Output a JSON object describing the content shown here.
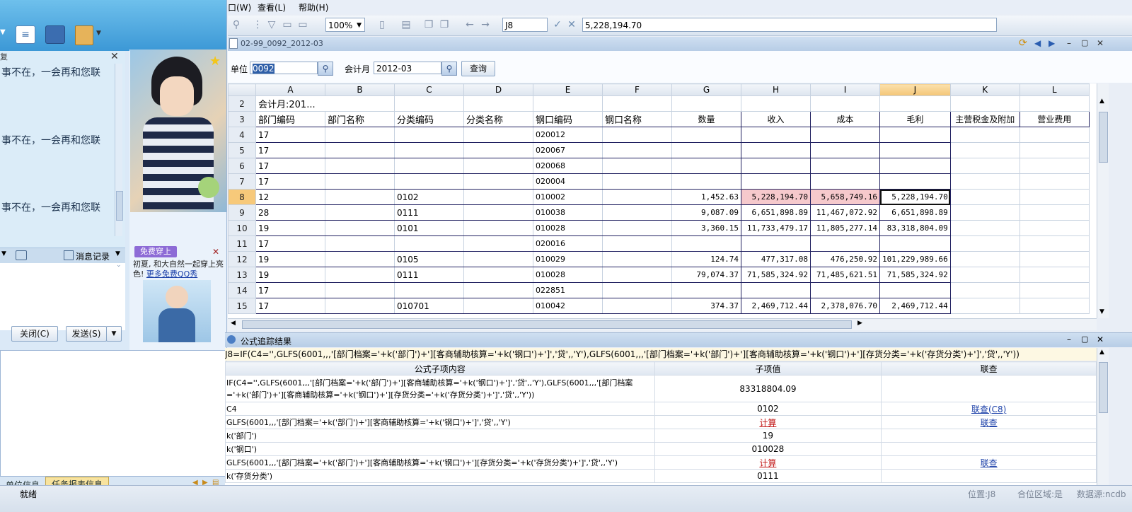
{
  "chat": {
    "messages": [
      "事不在，一会再和您联",
      "事不在，一会再和您联",
      "事不在，一会再和您联"
    ],
    "history_label": "消息记录",
    "close_btn": "关闭(C)",
    "send_btn": "发送(S)",
    "promo_badge": "免费穿上",
    "promo_text": "初夏, 和大自然一起穿上亮色!",
    "promo_link": "更多免费QQ秀",
    "tabs": [
      "单位信息",
      "任务报表信息"
    ]
  },
  "menu": {
    "items": [
      "口(W)",
      "查看(L)",
      "帮助(H)"
    ]
  },
  "toolbar": {
    "zoom": "100%",
    "cell_ref": "J8",
    "formula_value": "5,228,194.70"
  },
  "doc": {
    "title": "02-99_0092_2012-03"
  },
  "query": {
    "unit_label": "单位",
    "unit_value": "0092",
    "period_label": "会计月",
    "period_value": "2012-03",
    "query_btn": "查询"
  },
  "grid": {
    "col_letters": [
      "A",
      "B",
      "C",
      "D",
      "E",
      "F",
      "G",
      "H",
      "I",
      "J",
      "K",
      "L"
    ],
    "row2_label": "会计月:201...",
    "headers": [
      "部门编码",
      "部门名称",
      "分类编码",
      "分类名称",
      "钢口编码",
      "钢口名称",
      "数量",
      "收入",
      "成本",
      "毛利",
      "主营税金及附加",
      "营业费用"
    ],
    "rows": [
      {
        "n": "4",
        "a": "17",
        "c": "",
        "e": "020012",
        "g": "",
        "h": "",
        "i": "",
        "j": ""
      },
      {
        "n": "5",
        "a": "17",
        "c": "",
        "e": "020067",
        "g": "",
        "h": "",
        "i": "",
        "j": ""
      },
      {
        "n": "6",
        "a": "17",
        "c": "",
        "e": "020068",
        "g": "",
        "h": "",
        "i": "",
        "j": ""
      },
      {
        "n": "7",
        "a": "17",
        "c": "",
        "e": "020004",
        "g": "",
        "h": "",
        "i": "",
        "j": ""
      },
      {
        "n": "8",
        "a": "12",
        "c": "0102",
        "e": "010002",
        "g": "1,452.63",
        "h": "5,228,194.70",
        "i": "5,658,749.16",
        "j": "5,228,194.70"
      },
      {
        "n": "9",
        "a": "28",
        "c": "0111",
        "e": "010038",
        "g": "9,087.09",
        "h": "6,651,898.89",
        "i": "11,467,072.92",
        "j": "6,651,898.89"
      },
      {
        "n": "10",
        "a": "19",
        "c": "0101",
        "e": "010028",
        "g": "3,360.15",
        "h": "11,733,479.17",
        "i": "11,805,277.14",
        "j": "83,318,804.09"
      },
      {
        "n": "11",
        "a": "17",
        "c": "",
        "e": "020016",
        "g": "",
        "h": "",
        "i": "",
        "j": ""
      },
      {
        "n": "12",
        "a": "19",
        "c": "0105",
        "e": "010029",
        "g": "124.74",
        "h": "477,317.08",
        "i": "476,250.92",
        "j": "101,229,989.66"
      },
      {
        "n": "13",
        "a": "19",
        "c": "0111",
        "e": "010028",
        "g": "79,074.37",
        "h": "71,585,324.92",
        "i": "71,485,621.51",
        "j": "71,585,324.92"
      },
      {
        "n": "14",
        "a": "17",
        "c": "",
        "e": "022851",
        "g": "",
        "h": "",
        "i": "",
        "j": ""
      },
      {
        "n": "15",
        "a": "17",
        "c": "010701",
        "e": "010042",
        "g": "374.37",
        "h": "2,469,712.44",
        "i": "2,378,076.70",
        "j": "2,469,712.44"
      }
    ]
  },
  "trace": {
    "title": "公式追踪结果",
    "formula": "J8=IF(C4='',GLFS(6001,,,'[部门档案='+k('部门')+'][客商辅助核算='+k('钢口')+']','贷',,'Y'),GLFS(6001,,,'[部门档案='+k('部门')+'][客商辅助核算='+k('钢口')+'][存货分类='+k('存货分类')+']','贷',,'Y'))",
    "headers": [
      "公式子项内容",
      "子项值",
      "联查"
    ],
    "rows": [
      {
        "content": "IF(C4='',GLFS(6001,,,'[部门档案='+k('部门')+'][客商辅助核算='+k('钢口')+']','贷',,'Y'),GLFS(6001,,,'[部门档案='+k('部门')+'][客商辅助核算='+k('钢口')+'][存货分类='+k('存货分类')+']','贷',,'Y'))",
        "value": "83318804.09",
        "value_kind": "text",
        "link": ""
      },
      {
        "content": "C4",
        "value": "0102",
        "value_kind": "text",
        "link": "联查(C8)"
      },
      {
        "content": "GLFS(6001,,,'[部门档案='+k('部门')+'][客商辅助核算='+k('钢口')+']','贷',,'Y')",
        "value": "计算",
        "value_kind": "calc",
        "link": "联查"
      },
      {
        "content": "k('部门')",
        "value": "19",
        "value_kind": "text",
        "link": ""
      },
      {
        "content": "k('钢口')",
        "value": "010028",
        "value_kind": "text",
        "link": ""
      },
      {
        "content": "GLFS(6001,,,'[部门档案='+k('部门')+'][客商辅助核算='+k('钢口')+'][存货分类='+k('存货分类')+']','贷',,'Y')",
        "value": "计算",
        "value_kind": "calc",
        "link": "联查"
      },
      {
        "content": "k('存货分类')",
        "value": "0111",
        "value_kind": "text",
        "link": ""
      }
    ]
  },
  "status": {
    "ready": "就绪",
    "position": "位置:J8",
    "region": "合位区域:是",
    "datasource": "数据源:ncdb"
  },
  "colors": {
    "selected_row_header": "#f7c97a",
    "highlight_cell": "#f6c9cc",
    "calc_red": "#c21818",
    "link_blue": "#1a3fa8"
  }
}
